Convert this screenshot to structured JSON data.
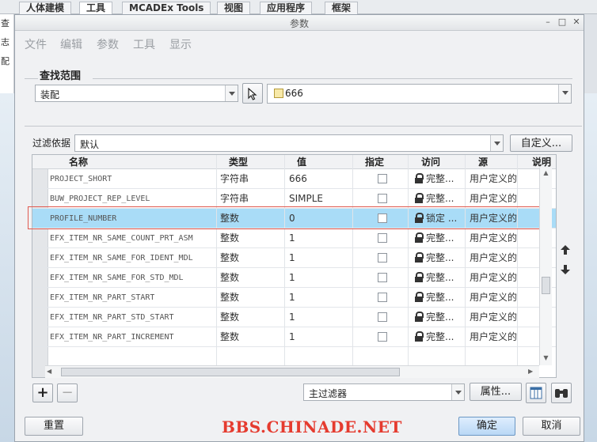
{
  "background_tabs": [
    "人体建模",
    "工具",
    "MCADEx Tools",
    "视图",
    "应用程序",
    "框架"
  ],
  "background_left": [
    "像",
    "查",
    "志",
    "配"
  ],
  "dialog": {
    "title": "参数",
    "window_buttons": [
      "–",
      "□",
      "✕"
    ]
  },
  "menu": [
    "文件",
    "编辑",
    "参数",
    "工具",
    "显示"
  ],
  "search": {
    "label": "查找范围",
    "scope_value": "装配",
    "model_value": "666"
  },
  "filter": {
    "label": "过滤依据",
    "value": "默认",
    "customize_label": "自定义..."
  },
  "table": {
    "headers": [
      "名称",
      "类型",
      "值",
      "指定",
      "访问",
      "源",
      "说明"
    ],
    "rows": [
      {
        "name": "PROJECT_SHORT",
        "type": "字符串",
        "value": "666",
        "access": "完整...",
        "source": "用户定义的"
      },
      {
        "name": "BUW_PROJECT_REP_LEVEL",
        "type": "字符串",
        "value": "SIMPLE",
        "access": "完整...",
        "source": "用户定义的"
      },
      {
        "name": "PROFILE_NUMBER",
        "type": "整数",
        "value": "0",
        "access": "锁定 ...",
        "source": "用户定义的"
      },
      {
        "name": "EFX_ITEM_NR_SAME_COUNT_PRT_ASM",
        "type": "整数",
        "value": "1",
        "access": "完整...",
        "source": "用户定义的"
      },
      {
        "name": "EFX_ITEM_NR_SAME_FOR_IDENT_MDL",
        "type": "整数",
        "value": "1",
        "access": "完整...",
        "source": "用户定义的"
      },
      {
        "name": "EFX_ITEM_NR_SAME_FOR_STD_MDL",
        "type": "整数",
        "value": "1",
        "access": "完整...",
        "source": "用户定义的"
      },
      {
        "name": "EFX_ITEM_NR_PART_START",
        "type": "整数",
        "value": "1",
        "access": "完整...",
        "source": "用户定义的"
      },
      {
        "name": "EFX_ITEM_NR_PART_STD_START",
        "type": "整数",
        "value": "1",
        "access": "完整...",
        "source": "用户定义的"
      },
      {
        "name": "EFX_ITEM_NR_PART_INCREMENT",
        "type": "整数",
        "value": "1",
        "access": "完整...",
        "source": "用户定义的"
      }
    ],
    "selected_row": 2
  },
  "bottom": {
    "main_filter_value": "主过滤器",
    "properties_label": "属性...",
    "reset_label": "重置",
    "ok_label": "确定",
    "cancel_label": "取消",
    "watermark": "BBS.CHINADE.NET"
  }
}
